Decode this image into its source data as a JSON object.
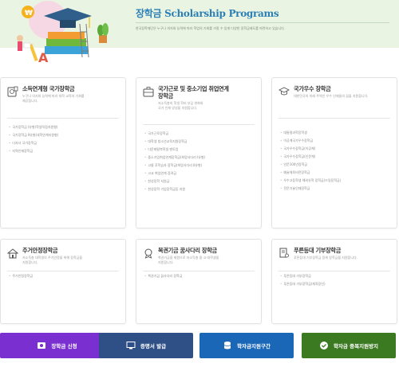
{
  "header": {
    "title": "장학금 Scholarship Programs",
    "subtitle": "한국장학재단은 누구나 의지와 능력에 따라 학업의 기회를 가질 수 있게 다양한 장학금제도를 마련하고 있습니다."
  },
  "cards": [
    {
      "icon": "income-linked-icon",
      "title": "소득연계형 국가장학금",
      "desc": "누구나 의지와 능력에 따라 대학 교육의 기회를\n제공합니다.",
      "items": [
        "국가장학금 Ⅰ유형(학생직접지원형)",
        "국가장학금 Ⅱ유형(대학연계지원형)",
        "다자녀 국가장학금",
        "지역인재장학금"
      ]
    },
    {
      "icon": "briefcase-icon",
      "title": "국가근로 및 중소기업 취업연계\n장학금",
      "desc": "저소득층의 학생 학비 부담 완화와\n국가 인재 양성을 지원합니다.",
      "items": [
        "국가근로장학금",
        "대학생 청소년교육지원장학금",
        "다문화탈북학생 멘토링",
        "중소기업취업연계장학금(희망사다리 Ⅰ유형)",
        "고졸 후학습자 장학금(희망사다리 Ⅱ유형)",
        "고교 취업연계 장려금",
        "한성장학 지원금",
        "한성장학 기업장학금등 지원"
      ]
    },
    {
      "icon": "graduation-cap-icon",
      "title": "국가우수 장학금",
      "desc": "대한민국의 미래 주역인 우수 인재들의 꿈을 지원합니다.",
      "items": [
        "대통령과학장학생",
        "이공계국가우수장학금",
        "국가우수장학금(이공계)",
        "국가우수장학금(인문계)",
        "인문100년장학금",
        "예술체육비전장학금",
        "우수고등학생 해외유학 장학금(드림장학금)",
        "전문기술인재장학금"
      ]
    },
    {
      "icon": "house-icon",
      "title": "주거안정장학금",
      "desc": "저소득층 대학생의 주거안정을 위해 장학금을\n지원합니다.",
      "items": [
        "주거안정장학금"
      ]
    },
    {
      "icon": "medal-icon",
      "title": "복권기금 꿈사다리 장학금",
      "desc": "복권기금을 재원으로 저소득층 중·고·대학생을\n지원합니다.",
      "items": [
        "복권기금 꿈사다리 장학금"
      ]
    },
    {
      "icon": "certificate-icon",
      "title": "푸른등대 기부장학금",
      "desc": "푸른등대 기부장학금 등에 장학금을 지원합니다.",
      "items": [
        "푸른등대 기부장학금",
        "푸른등대 기부장학금(체육장인)"
      ]
    }
  ],
  "buttons": [
    {
      "label": "장학금 신청",
      "icon": "scholarship-apply-icon",
      "color": "#7a2fd0"
    },
    {
      "label": "증명서 발급",
      "icon": "certificate-issue-icon",
      "color": "#2f4f87"
    },
    {
      "label": "학자금지원구간",
      "icon": "database-icon",
      "color": "#1a67b8"
    },
    {
      "label": "학자금 중복지원방지",
      "icon": "check-circle-icon",
      "color": "#3c7a22"
    }
  ],
  "colors": {
    "header_bg": "#eaf4e3",
    "title": "#2b7fb4"
  }
}
